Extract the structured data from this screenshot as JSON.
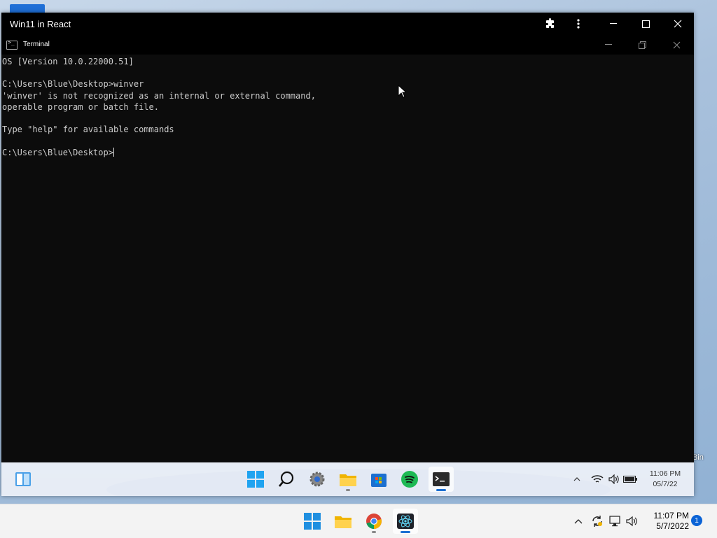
{
  "outer_window": {
    "title": "Win11 in React"
  },
  "terminal": {
    "title": "Terminal",
    "lines": [
      "OS [Version 10.0.22000.51]",
      "",
      "C:\\Users\\Blue\\Desktop>winver",
      "'winver' is not recognized as an internal or external command,",
      "operable program or batch file.",
      "",
      "Type \"help\" for available commands",
      "",
      "C:\\Users\\Blue\\Desktop>"
    ]
  },
  "desktop": {
    "bin_label": "Bin"
  },
  "inner_taskbar": {
    "icons": [
      "widgets-icon",
      "start-icon",
      "search-icon",
      "settings-icon",
      "file-explorer-icon",
      "store-icon",
      "spotify-icon",
      "terminal-icon"
    ],
    "time": "11:06 PM",
    "date": "05/7/22"
  },
  "host_taskbar": {
    "icons": [
      "start-icon",
      "file-explorer-icon",
      "chrome-icon",
      "react-app-icon"
    ],
    "time": "11:07 PM",
    "date": "5/7/2022",
    "notification_count": "1"
  },
  "colors": {
    "terminal_bg": "#0c0c0c",
    "terminal_text": "#cccccc",
    "accent": "#0b63d6"
  }
}
